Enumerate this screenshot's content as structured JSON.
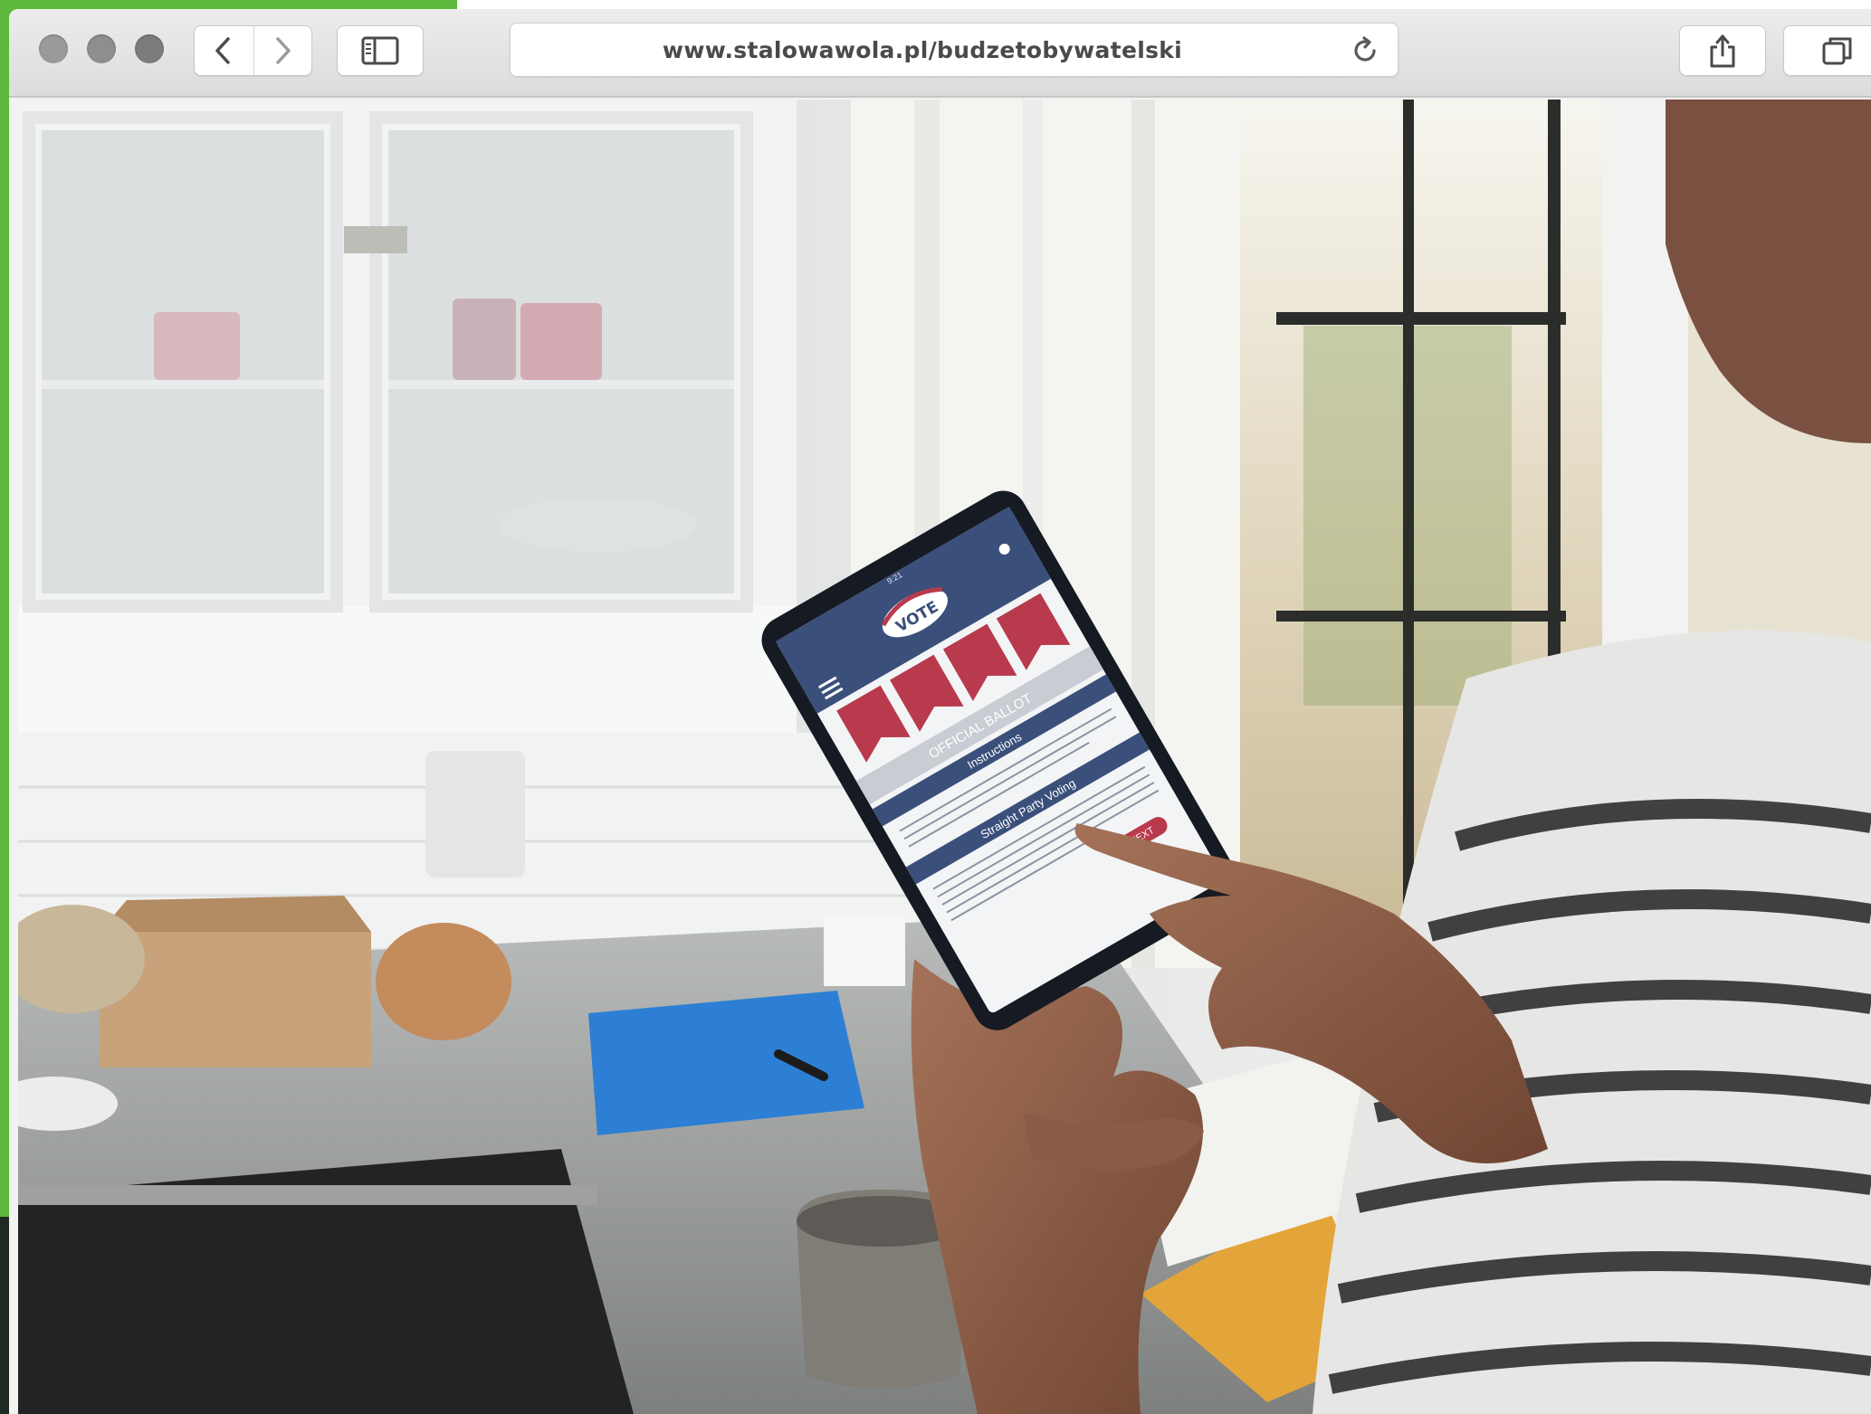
{
  "browser": {
    "url": "www.stalowawola.pl/budzetobywatelski",
    "toolbar": {
      "back_icon": "chevron-left-icon",
      "forward_icon": "chevron-right-icon",
      "sidebar_icon": "sidebar-icon",
      "reload_icon": "reload-icon",
      "share_icon": "share-icon",
      "tabs_icon": "tabs-icon"
    }
  },
  "tablet_screen": {
    "time": "9:21",
    "logo_text": "VOTE",
    "banner": "OFFICIAL BALLOT",
    "section1_title": "Instructions",
    "section2_title": "Straight Party Voting",
    "next_button": "NEXT"
  },
  "colors": {
    "accent_green": "#5cb83a",
    "ballot_red": "#b83a4c",
    "ballot_navy": "#3a4f7a",
    "folder_blue": "#2c7fd4"
  }
}
